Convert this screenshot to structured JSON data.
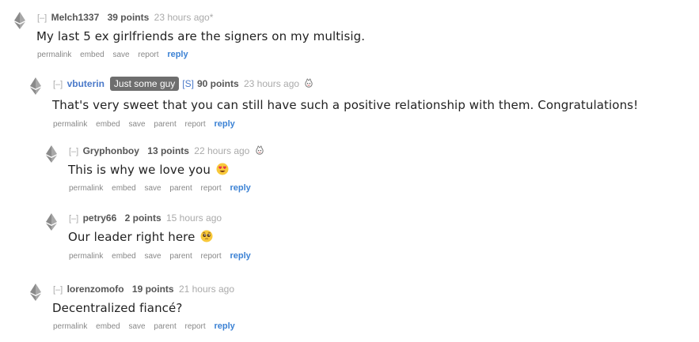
{
  "icons": {
    "vote": "ethereum-diamond-icon",
    "award": "award-icon",
    "heart_eyes": "heart-eyes-emoji-icon",
    "pleading": "pleading-face-emoji-icon"
  },
  "colors": {
    "op_author": "#4a79c9",
    "reply_link": "#3c82d4",
    "flair_bg": "#6e6e6e"
  },
  "expand_label": "[–]",
  "comments": [
    {
      "author": "Melch1337",
      "score": "39 points",
      "time": "23 hours ago",
      "edited_mark": "*",
      "body": "My last 5 ex girlfriends are the signers on my multisig.",
      "buttons": [
        "permalink",
        "embed",
        "save",
        "report"
      ],
      "reply": "reply"
    },
    {
      "author": "vbuterin",
      "flair": "Just some guy",
      "submitter_tag": "[S]",
      "score": "90 points",
      "time": "23 hours ago",
      "body": "That's very sweet that you can still have such a positive relationship with them. Congratulations!",
      "buttons": [
        "permalink",
        "embed",
        "save",
        "parent",
        "report"
      ],
      "reply": "reply"
    },
    {
      "author": "Gryphonboy",
      "score": "13 points",
      "time": "22 hours ago",
      "body": "This is why we love you",
      "buttons": [
        "permalink",
        "embed",
        "save",
        "parent",
        "report"
      ],
      "reply": "reply"
    },
    {
      "author": "petry66",
      "score": "2 points",
      "time": "15 hours ago",
      "body": "Our leader right here",
      "buttons": [
        "permalink",
        "embed",
        "save",
        "parent",
        "report"
      ],
      "reply": "reply"
    },
    {
      "author": "lorenzomofo",
      "score": "19 points",
      "time": "21 hours ago",
      "body": "Decentralized fiancé?",
      "buttons": [
        "permalink",
        "embed",
        "save",
        "parent",
        "report"
      ],
      "reply": "reply"
    }
  ]
}
